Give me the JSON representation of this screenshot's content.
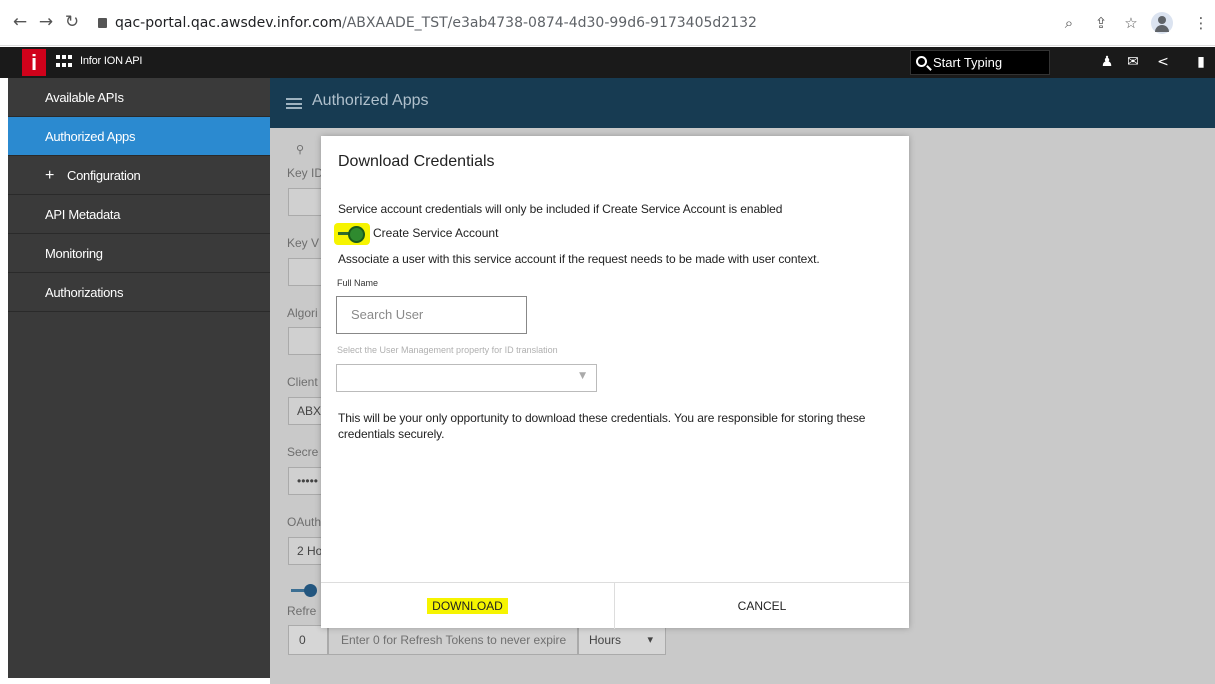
{
  "browser": {
    "url_host": "qac-portal.qac.awsdev.infor.com",
    "url_path": "/ABXAADE_TST/e3ab4738-0874-4d30-99d6-9173405d2132"
  },
  "app": {
    "logo_letter": "i",
    "name": "Infor ION API",
    "search_placeholder": "Start Typing"
  },
  "sidebar": {
    "items": [
      {
        "label": "Available APIs"
      },
      {
        "label": "Authorized Apps"
      },
      {
        "label": "Configuration"
      },
      {
        "label": "API Metadata"
      },
      {
        "label": "Monitoring"
      },
      {
        "label": "Authorizations"
      }
    ],
    "plus_symbol": "+"
  },
  "main": {
    "title": "Authorized Apps"
  },
  "background_form": {
    "labels": [
      "Key ID",
      "Key V",
      "Algori",
      "Client",
      "Secre",
      "OAuth",
      "Refre"
    ],
    "client_value": "ABX",
    "secret_value": "•••••",
    "oauth_value": "2 Ho",
    "refresh_value": "0",
    "refresh_hint": "Enter 0 for Refresh Tokens to never expire",
    "refresh_unit": "Hours"
  },
  "modal": {
    "title": "Download Credentials",
    "service_notice": "Service account credentials will only be included if Create Service Account is enabled",
    "toggle_label": "Create Service Account",
    "toggle_on": true,
    "associate_text": "Associate a user with this service account if the request needs to be made with user context.",
    "full_name_label": "Full Name",
    "search_user_placeholder": "Search User",
    "id_translation_label": "Select the User Management property for ID translation",
    "warning_line1": "This will be your only opportunity to download these credentials. You are responsible for storing these",
    "warning_line2": "credentials securely.",
    "download_label": "DOWNLOAD",
    "cancel_label": "CANCEL"
  },
  "colors": {
    "sidebar_bg": "#3a3a3a",
    "sidebar_active": "#2b8ad0",
    "main_header": "#173b52",
    "highlight": "#f6f400",
    "logo_red": "#d0021b"
  }
}
